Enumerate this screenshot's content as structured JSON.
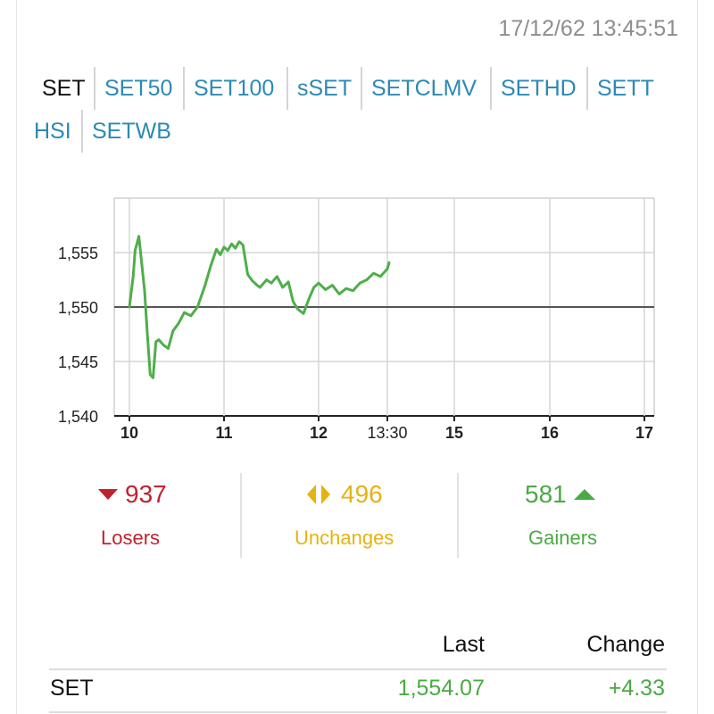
{
  "timestamp": "17/12/62 13:45:51",
  "tabs": [
    {
      "label": "SET",
      "active": true
    },
    {
      "label": "SET50"
    },
    {
      "label": "SET100"
    },
    {
      "label": "sSET"
    },
    {
      "label": "SETCLMV"
    },
    {
      "label": "SETHD"
    },
    {
      "label": "SETT"
    },
    {
      "label": "HSI"
    },
    {
      "label": "SETWB"
    }
  ],
  "chart_data": {
    "type": "line",
    "x_tick_labels": [
      "10",
      "11",
      "12",
      "13:30",
      "15",
      "16",
      "17"
    ],
    "y_tick_labels": [
      "1,555",
      "1,550",
      "1,545",
      "1,540"
    ],
    "ylim": [
      1540,
      1560
    ],
    "previous_close": 1550.0,
    "series": [
      {
        "color": "#4fae4a",
        "x": [
          10.0,
          10.04,
          10.06,
          10.1,
          10.13,
          10.16,
          10.19,
          10.22,
          10.25,
          10.28,
          10.31,
          10.36,
          10.41,
          10.46,
          10.52,
          10.58,
          10.65,
          10.72,
          10.8,
          10.86,
          10.92,
          10.96,
          11.0,
          11.04,
          11.08,
          11.12,
          11.16,
          11.2,
          11.25,
          11.3,
          11.35,
          11.38,
          11.45,
          11.5,
          11.56,
          11.62,
          11.68,
          11.73,
          11.78,
          11.84,
          11.9,
          11.95,
          12.0,
          12.05,
          12.1,
          12.15,
          12.2,
          12.25,
          12.3,
          12.35,
          12.4,
          12.45,
          12.5,
          12.55
        ],
        "y": [
          1550.0,
          1552.8,
          1555.2,
          1556.5,
          1554.0,
          1551.5,
          1547.5,
          1543.8,
          1543.5,
          1546.8,
          1547.0,
          1546.5,
          1546.2,
          1547.8,
          1548.5,
          1549.5,
          1549.2,
          1550.0,
          1552.0,
          1553.8,
          1555.3,
          1554.8,
          1555.5,
          1555.2,
          1555.8,
          1555.4,
          1556.0,
          1555.7,
          1553.0,
          1552.4,
          1552.0,
          1551.8,
          1552.5,
          1552.2,
          1552.8,
          1551.8,
          1552.3,
          1550.5,
          1549.8,
          1549.4,
          1550.8,
          1551.8,
          1552.2,
          1551.6,
          1552.0,
          1551.2,
          1551.7,
          1551.5,
          1552.2,
          1552.5,
          1553.1,
          1552.8,
          1553.5,
          1554.07
        ]
      }
    ]
  },
  "stats": {
    "losers": {
      "count": "937",
      "label": "Losers"
    },
    "unchanges": {
      "count": "496",
      "label": "Unchanges"
    },
    "gainers": {
      "count": "581",
      "label": "Gainers"
    }
  },
  "table": {
    "headers": {
      "last": "Last",
      "change": "Change"
    },
    "rows": [
      {
        "name": "SET",
        "last": "1,554.07",
        "change": "+4.33"
      }
    ]
  },
  "colors": {
    "green": "#4aaa44",
    "red": "#c0212f",
    "yellow": "#e5b311",
    "link": "#2b8ab3"
  }
}
